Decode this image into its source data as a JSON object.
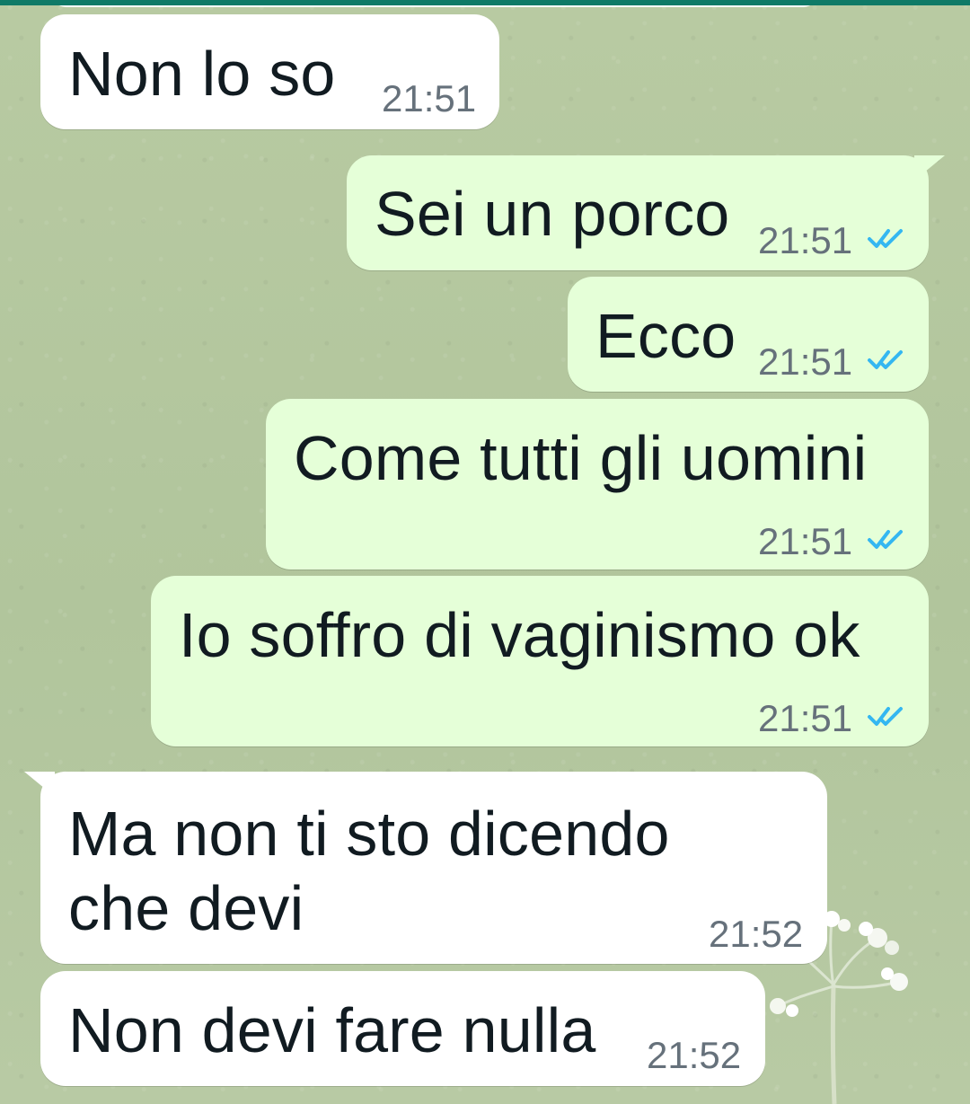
{
  "theme": {
    "wallpaper": "#b3c79e",
    "incoming_bubble": "#ffffff",
    "outgoing_bubble": "#e5ffd8",
    "text": "#111b21",
    "timestamp": "#66717b",
    "read_receipt": "#34b7f1",
    "top_strip": "#0f7a67"
  },
  "messages": [
    {
      "type": "incoming",
      "text": "Non lo so",
      "time": "21:51"
    },
    {
      "type": "outgoing",
      "text": "Sei un porco",
      "time": "21:51",
      "status_icon": "double-check-icon"
    },
    {
      "type": "outgoing",
      "text": "Ecco",
      "time": "21:51",
      "status_icon": "double-check-icon"
    },
    {
      "type": "outgoing",
      "text": "Come tutti gli uomini",
      "time": "21:51",
      "status_icon": "double-check-icon"
    },
    {
      "type": "outgoing",
      "text": "Io soffro di vaginismo ok",
      "time": "21:51",
      "status_icon": "double-check-icon"
    },
    {
      "type": "incoming",
      "text": "Ma non ti sto dicendo che devi",
      "time": "21:52"
    },
    {
      "type": "incoming",
      "text": "Non devi fare nulla",
      "time": "21:52"
    }
  ]
}
